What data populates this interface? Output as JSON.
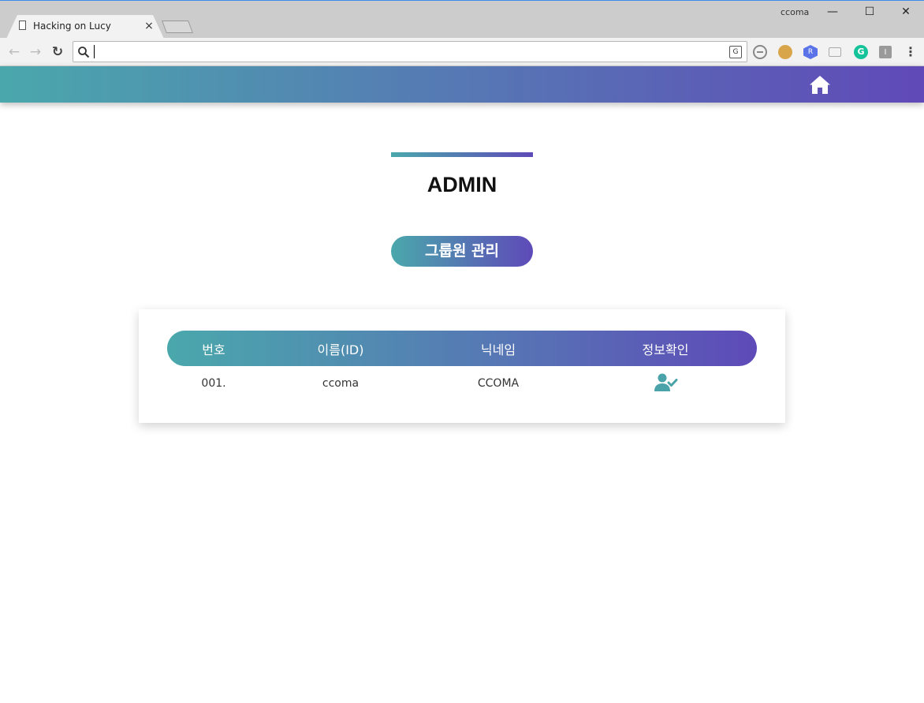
{
  "browser": {
    "tab_title": "Hacking on Lucy",
    "tab_close": "×",
    "profile_name": "ccoma",
    "window_minimize": "—",
    "window_maximize": "☐",
    "window_close": "✕",
    "nav_back": "←",
    "nav_forward": "→",
    "nav_reload": "↻",
    "address_value": "",
    "translate_glyph": "G",
    "ext_r": "R",
    "ext_g": "G",
    "ext_i": "I",
    "menu": "⋮"
  },
  "page": {
    "title": "ADMIN",
    "section_button": "그룹원 관리"
  },
  "table": {
    "headers": [
      "번호",
      "이름(ID)",
      "닉네임",
      "정보확인"
    ],
    "rows": [
      {
        "number": "001.",
        "id": "ccoma",
        "nickname": "CCOMA",
        "action_icon": "user-check-icon"
      }
    ]
  },
  "colors": {
    "gradient_start": "#4aa8ac",
    "gradient_end": "#5e4ab8",
    "icon_teal": "#4aa3a8"
  }
}
